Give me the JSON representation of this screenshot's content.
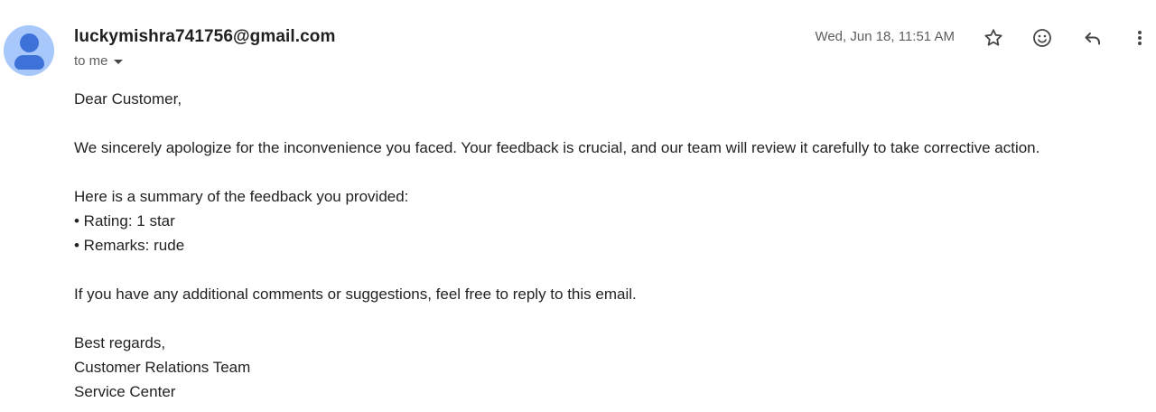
{
  "email": {
    "sender": "luckymishra741756@gmail.com",
    "recipient_label": "to me",
    "date": "Wed, Jun 18, 11:51 AM"
  },
  "actions": {
    "star_icon": "star-outline-icon",
    "emoji_icon": "emoji-reaction-icon",
    "reply_icon": "reply-arrow-icon",
    "more_icon": "more-vertical-icon"
  },
  "body": {
    "greeting": "Dear Customer,",
    "apology": "We sincerely apologize for the inconvenience you faced. Your feedback is crucial, and our team will review it carefully to take corrective action.",
    "summary_intro": "Here is a summary of the feedback you provided:",
    "rating_line": "• Rating: 1 star",
    "remarks_line": "• Remarks: rude",
    "followup": "If you have any additional comments or suggestions, feel free to reply to this email.",
    "closing": "Best regards,",
    "signature_team": "Customer Relations Team",
    "signature_org": "Service Center"
  },
  "colors": {
    "avatar_background": "#a8c7fa",
    "avatar_figure": "#3d72d8",
    "meta_text": "#5e5e5e",
    "icon": "#444746"
  }
}
